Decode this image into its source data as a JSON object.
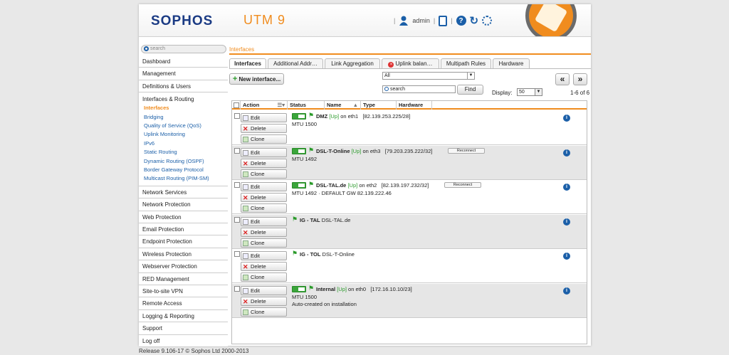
{
  "header": {
    "logo": "SOPHOS",
    "product": "UTM 9",
    "user": "admin",
    "sep": "|"
  },
  "search": {
    "placeholder": "search"
  },
  "breadcrumb": "Interfaces",
  "sidebar": {
    "items_top": [
      "Dashboard",
      "Management",
      "Definitions & Users"
    ],
    "group": {
      "title": "Interfaces & Routing",
      "subs": [
        "Interfaces",
        "Bridging",
        "Quality of Service (QoS)",
        "Uplink Monitoring",
        "IPv6",
        "Static Routing",
        "Dynamic Routing (OSPF)",
        "Border Gateway Protocol",
        "Multicast Routing (PIM-SM)"
      ]
    },
    "items_bottom": [
      "Network Services",
      "Network Protection",
      "Web Protection",
      "Email Protection",
      "Endpoint Protection",
      "Wireless Protection",
      "Webserver Protection",
      "RED Management",
      "Site-to-site VPN",
      "Remote Access",
      "Logging & Reporting",
      "Support",
      "Log off"
    ]
  },
  "tabs": [
    "Interfaces",
    "Additional Addr…",
    "Link Aggregation",
    "Uplink balan…",
    "Multipath Rules",
    "Hardware"
  ],
  "toolbar": {
    "new_interface": "New interface...",
    "filter_value": "All",
    "search_placeholder": "search",
    "find": "Find",
    "display_label": "Display:",
    "display_value": "50",
    "range": "1-6 of 6",
    "prev": "«",
    "next": "»"
  },
  "columns": {
    "action": "Action",
    "status": "Status",
    "name": "Name",
    "type": "Type",
    "hardware": "Hardware"
  },
  "actions": {
    "edit": "Edit",
    "delete": "Delete",
    "clone": "Clone",
    "reconnect": "Reconnect"
  },
  "rows": [
    {
      "name": "DMZ",
      "up": "[Up]",
      "dev": "on eth1",
      "addr": "[82.139.253.225/28]",
      "line1": "MTU 1500",
      "line2": "",
      "toggle": true,
      "reconnect": false
    },
    {
      "name": "DSL-T-Online",
      "up": "[Up]",
      "dev": "on eth3",
      "addr": "[79.203.235.222/32]",
      "line1": "MTU 1492",
      "line2": "",
      "toggle": true,
      "reconnect": true
    },
    {
      "name": "DSL-TAL.de",
      "up": "[Up]",
      "dev": "on eth2",
      "addr": "[82.139.197.232/32]",
      "line1": "MTU 1492 · DEFAULT GW 82.139.222.46",
      "line2": "",
      "toggle": true,
      "reconnect": true
    },
    {
      "name": "IG - TAL",
      "up": "",
      "dev": "DSL-TAL.de",
      "addr": "",
      "line1": "",
      "line2": "",
      "toggle": false,
      "reconnect": false
    },
    {
      "name": "IG - TOL",
      "up": "",
      "dev": "DSL-T-Online",
      "addr": "",
      "line1": "",
      "line2": "",
      "toggle": false,
      "reconnect": false
    },
    {
      "name": "Internal",
      "up": "[Up]",
      "dev": "on eth0",
      "addr": "[172.16.10.10/23]",
      "line1": "MTU 1500",
      "line2": "Auto-created on installation",
      "toggle": true,
      "reconnect": false
    }
  ],
  "footer": "Release 9.106-17 © Sophos Ltd 2000-2013",
  "colors": {
    "brand": "#1b3b84",
    "accent": "#f08c1e",
    "link": "#1b5fa8",
    "up": "#2a9a2a"
  }
}
